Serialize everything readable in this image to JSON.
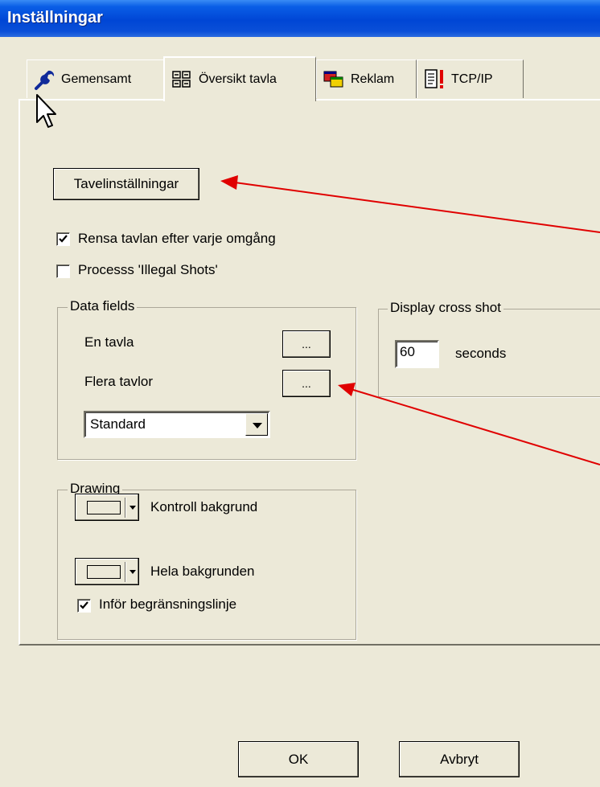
{
  "window": {
    "title": "Inställningar"
  },
  "tabs": [
    {
      "label": "Gemensamt",
      "icon": "wrench-icon"
    },
    {
      "label": "Översikt tavla",
      "icon": "grid-icon",
      "active": true
    },
    {
      "label": "Reklam",
      "icon": "windows-icon"
    },
    {
      "label": "TCP/IP",
      "icon": "document-alert-icon"
    }
  ],
  "main": {
    "board_settings_button": "Tavelinställningar",
    "clear_board_checkbox": {
      "label": "Rensa tavlan efter varje omgång",
      "checked": true
    },
    "illegal_shots_checkbox": {
      "label": "Processs 'Illegal Shots'",
      "checked": false
    }
  },
  "data_fields": {
    "title": "Data fields",
    "single_board_label": "En tavla",
    "multiple_boards_label": "Flera tavlor",
    "ellipsis_label": "...",
    "select_value": "Standard"
  },
  "cross_shot": {
    "title": "Display cross shot",
    "value": "60",
    "unit": "seconds"
  },
  "drawing": {
    "title": "Drawing",
    "control_background_label": "Kontroll bakgrund",
    "whole_background_label": "Hela bakgrunden",
    "boundary_line_checkbox": {
      "label": "Inför begränsningslinje",
      "checked": true
    }
  },
  "footer": {
    "ok_label": "OK",
    "cancel_label": "Avbryt"
  },
  "colors": {
    "titlebar": "#0046d5",
    "dialog_bg": "#ece9d8",
    "annotation_arrow": "#e00000"
  }
}
